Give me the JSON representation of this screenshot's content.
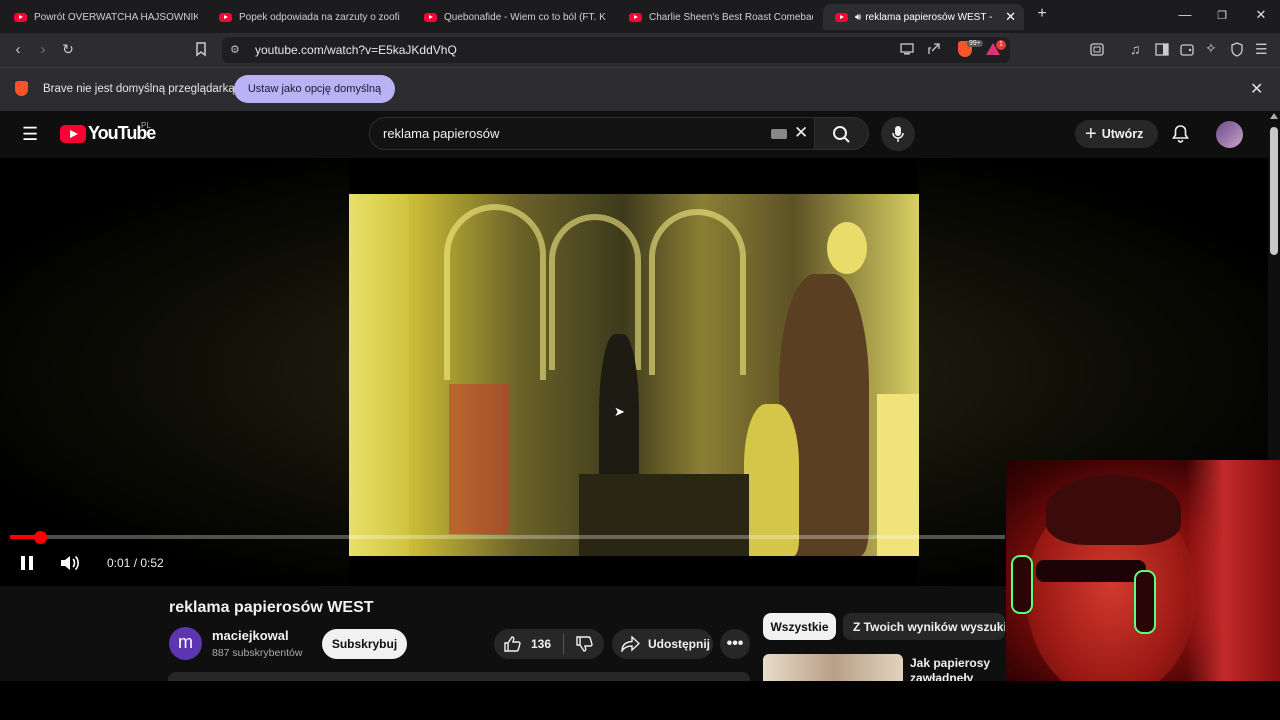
{
  "browser": {
    "tabs": [
      {
        "label": "Powrót OVERWATCHA HAJSOWNIKÓ",
        "active": false
      },
      {
        "label": "Popek odpowiada na zarzuty o zoofi",
        "active": false
      },
      {
        "label": "Quebonafide - Wiem co to ból (FT. K",
        "active": false
      },
      {
        "label": "Charlie Sheen's Best Roast Comeback",
        "active": false
      },
      {
        "label": "reklama papierosów WEST - Y",
        "active": true
      }
    ],
    "url": "youtube.com/watch?v=E5kaJKddVhQ",
    "shields_badge": "99+",
    "rewards_badge": "1",
    "infobar": {
      "message": "Brave nie jest domyślną przeglądarką",
      "button": "Ustaw jako opcję domyślną"
    }
  },
  "youtube": {
    "logo_text": "YouTube",
    "region": "PL",
    "search_query": "reklama papierosów",
    "create_label": "Utwórz",
    "player": {
      "time_current": "0:01",
      "time_total": "0:52",
      "progress": 0.03
    },
    "video": {
      "title": "reklama papierosów WEST",
      "channel": "maciejkowal",
      "channel_initial": "m",
      "subscribers": "887 subskrybentów",
      "subscribe_label": "Subskrybuj",
      "likes": "136",
      "share_label": "Udostępnij"
    },
    "chips": [
      "Wszystkie",
      "Z Twoich wyników wyszukiwania"
    ],
    "recommended": [
      {
        "title": "Jak papierosy zawładnęły światem? Reklamy"
      }
    ]
  },
  "colors": {
    "accent_red": "#ff0000",
    "youtube_red": "#ff0033",
    "brave_orange": "#fb542b",
    "infobar_button": "#b9b3f5"
  }
}
